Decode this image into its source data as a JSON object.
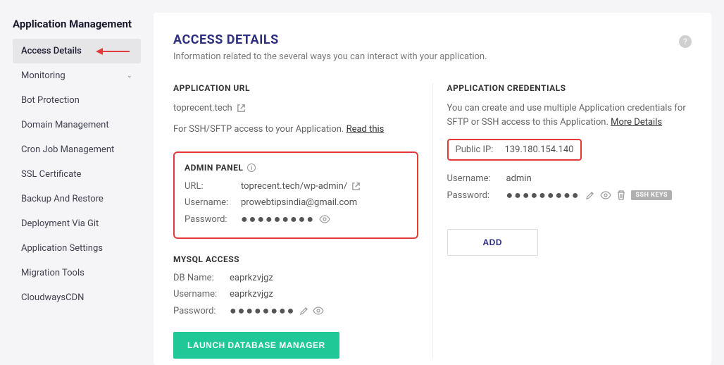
{
  "sidebar": {
    "title": "Application Management",
    "items": [
      {
        "label": "Access Details",
        "active": true
      },
      {
        "label": "Monitoring",
        "expandable": true
      },
      {
        "label": "Bot Protection"
      },
      {
        "label": "Domain Management"
      },
      {
        "label": "Cron Job Management"
      },
      {
        "label": "SSL Certificate"
      },
      {
        "label": "Backup And Restore"
      },
      {
        "label": "Deployment Via Git"
      },
      {
        "label": "Application Settings"
      },
      {
        "label": "Migration Tools"
      },
      {
        "label": "CloudwaysCDN"
      }
    ]
  },
  "page": {
    "title": "ACCESS DETAILS",
    "subtitle": "Information related to the several ways you can interact with your application."
  },
  "app_url": {
    "heading": "APPLICATION URL",
    "url": "toprecent.tech",
    "note_prefix": "For SSH/SFTP access to your Application. ",
    "note_link": "Read this"
  },
  "admin_panel": {
    "heading": "ADMIN PANEL",
    "url_label": "URL:",
    "url_value": "toprecent.tech/wp-admin/",
    "username_label": "Username:",
    "username_value": "prowebtipsindia@gmail.com",
    "password_label": "Password:",
    "password_mask": "●●●●●●●●●"
  },
  "mysql": {
    "heading": "MYSQL ACCESS",
    "dbname_label": "DB Name:",
    "dbname_value": "eaprkzvjgz",
    "username_label": "Username:",
    "username_value": "eaprkzvjgz",
    "password_label": "Password:",
    "password_mask": "●●●●●●●●"
  },
  "launch_button": "LAUNCH DATABASE MANAGER",
  "credentials": {
    "heading": "APPLICATION CREDENTIALS",
    "desc_prefix": "You can create and use multiple Application credentials for SFTP or SSH access to this Application. ",
    "desc_link": "More Details",
    "public_ip_label": "Public IP:",
    "public_ip_value": "139.180.154.140",
    "username_label": "Username:",
    "username_value": "admin",
    "password_label": "Password:",
    "password_mask": "●●●●●●●●●",
    "ssh_keys": "SSH KEYS",
    "add_button": "ADD"
  }
}
